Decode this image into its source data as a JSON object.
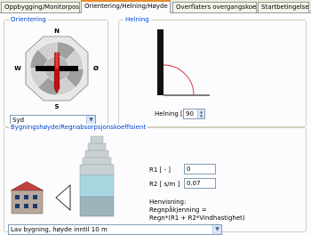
{
  "tabs": [
    {
      "label": "Oppbygging/Monitorposisjoner"
    },
    {
      "label": "Orientering/Helning/Høyde"
    },
    {
      "label": "Overflaters overgangskoeff."
    },
    {
      "label": "Startbetingelser"
    }
  ],
  "orientation": {
    "title": "Orientering",
    "compass": {
      "n": "N",
      "s": "S",
      "w": "W",
      "e": "Ø"
    },
    "direction_value": "Syd"
  },
  "tilt": {
    "title": "Helning",
    "label": "Helning [°]",
    "value": "90"
  },
  "building": {
    "title": "Bygningshøyde/Regnabsorpsjonskoeffisient",
    "r1_label": "R1 [ - ]",
    "r1_value": "0",
    "r2_label": "R2 [ s/m ]",
    "r2_value": "0.07",
    "note_line1": "Henvisning:",
    "note_line2": "Regnpåkjenning =",
    "note_line3": "Regn*(R1 + R2*Vindhastighet)",
    "height_select": "Lav bygning, høyde inntil 10 m"
  },
  "colors": {
    "accent": "#e68b2c",
    "group_title": "#0046d5",
    "house_wall": "#b5a79c",
    "roof": "#c04040"
  }
}
